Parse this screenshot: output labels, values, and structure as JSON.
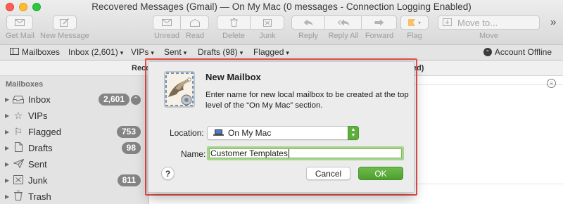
{
  "window": {
    "title": "Recovered Messages (Gmail) — On My Mac (0 messages - Connection Logging Enabled)"
  },
  "toolbar": {
    "get_mail": "Get Mail",
    "new_message": "New Message",
    "unread": "Unread",
    "read": "Read",
    "delete": "Delete",
    "junk": "Junk",
    "reply": "Reply",
    "reply_all": "Reply All",
    "forward": "Forward",
    "flag": "Flag",
    "move_to": "Move to...",
    "move": "Move",
    "overflow": "»"
  },
  "favorites": {
    "mailboxes": "Mailboxes",
    "inbox": "Inbox (2,601)",
    "vips": "VIPs",
    "sent": "Sent",
    "drafts": "Drafts (98)",
    "flagged": "Flagged",
    "account_status": "Account Offline"
  },
  "column_header": {
    "left": "Recov",
    "right": "abled)"
  },
  "sidebar": {
    "header": "Mailboxes",
    "items": [
      {
        "label": "Inbox",
        "icon": "inbox-icon",
        "badge": "2,601"
      },
      {
        "label": "VIPs",
        "icon": "star-icon",
        "badge": ""
      },
      {
        "label": "Flagged",
        "icon": "flag-icon",
        "badge": "753"
      },
      {
        "label": "Drafts",
        "icon": "document-icon",
        "badge": "98"
      },
      {
        "label": "Sent",
        "icon": "paper-plane-icon",
        "badge": ""
      },
      {
        "label": "Junk",
        "icon": "junk-icon",
        "badge": "811"
      },
      {
        "label": "Trash",
        "icon": "trash-icon",
        "badge": ""
      }
    ]
  },
  "dialog": {
    "title": "New Mailbox",
    "message": "Enter name for new local mailbox to be created at the top level of the “On My Mac” section.",
    "location_label": "Location:",
    "location_value": "On My Mac",
    "name_label": "Name:",
    "name_value": "Customer Templates",
    "help": "?",
    "cancel": "Cancel",
    "ok": "OK"
  },
  "colors": {
    "accent_green": "#5fae3e",
    "highlight_red": "#e8504a",
    "badge_gray": "#848484"
  }
}
